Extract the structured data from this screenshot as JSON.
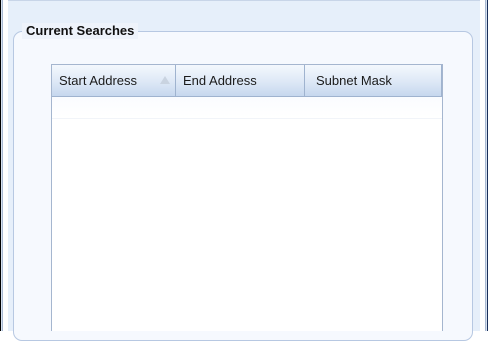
{
  "group": {
    "title": "Current Searches"
  },
  "table": {
    "columns": [
      {
        "label": "Start Address",
        "sort": "ascending"
      },
      {
        "label": "End Address"
      },
      {
        "label": "Subnet Mask"
      }
    ],
    "rows": []
  },
  "icons": {
    "sort_indicator": "sort-ascending-icon"
  },
  "colors": {
    "panel_background": "#e6effa",
    "header_gradient_top": "#f4f8fd",
    "header_gradient_bottom": "#c6d7ee",
    "border": "#a5b6cf"
  }
}
